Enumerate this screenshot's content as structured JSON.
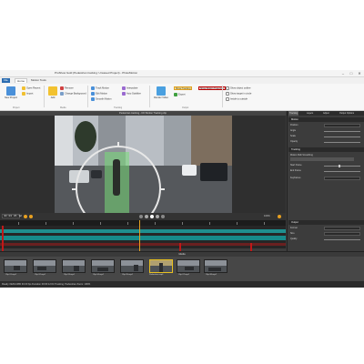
{
  "window": {
    "title": "ProShow Gold (Pedestrian tracking: Unsaved Project) - PhotoMotion",
    "minimize": "–",
    "maximize": "□",
    "close": "✕"
  },
  "menu": {
    "tabs": [
      {
        "label": "File"
      },
      {
        "label": "Home"
      },
      {
        "label": "Motion Tools"
      }
    ]
  },
  "ribbon": {
    "buttons": [
      {
        "label": "New Project"
      },
      {
        "label": "Open Recent"
      },
      {
        "label": "Import"
      },
      {
        "label": "Add"
      },
      {
        "label": "Remove"
      },
      {
        "label": "Change Background"
      },
      {
        "label": "Track Motion"
      },
      {
        "label": "Edit Motion"
      },
      {
        "label": "Smooth Motion"
      },
      {
        "label": "Interpolate"
      },
      {
        "label": "Auto Stabilize"
      },
      {
        "label": "Render Video"
      },
      {
        "label": "Export"
      }
    ],
    "tags": [
      {
        "label": "Show Tracking"
      },
      {
        "label": "Show Motion Trajectory"
      }
    ],
    "groups": [
      {
        "label": "Project"
      },
      {
        "label": "Media"
      },
      {
        "label": "Tracking"
      },
      {
        "label": "Output"
      }
    ],
    "options": [
      {
        "label": "Show object outline"
      },
      {
        "label": "Show target in circle"
      },
      {
        "label": "Inside to outside"
      }
    ]
  },
  "viewer": {
    "header": "Pedestrian tracking - DO Motion Tracking clip",
    "timecode": "00:00:06:12",
    "zoom": "100%"
  },
  "panel": {
    "tabs": [
      {
        "label": "Tracking"
      },
      {
        "label": "Layers"
      },
      {
        "label": "Adjust"
      },
      {
        "label": "Output Options"
      }
    ],
    "sections": [
      {
        "label": "Motion"
      },
      {
        "label": "Tracking"
      },
      {
        "label": "Output"
      }
    ],
    "rows": [
      {
        "label": "Position"
      },
      {
        "label": "Angle"
      },
      {
        "label": "Scale"
      },
      {
        "label": "Opacity"
      },
      {
        "label": "Motion Path Smoothing"
      },
      {
        "label": "Start Frame"
      },
      {
        "label": "End Frame"
      },
      {
        "label": "Keyframes"
      },
      {
        "label": "Format"
      },
      {
        "label": "Size"
      },
      {
        "label": "Quality"
      }
    ]
  },
  "gallery": {
    "header": "Media",
    "items": [
      {
        "label": "Clip 01.mp4"
      },
      {
        "label": "Clip 02.mp4"
      },
      {
        "label": "Clip 03.mp4"
      },
      {
        "label": "Clip 04.mp4"
      },
      {
        "label": "Clip 05.mp4"
      },
      {
        "label": "Pedestrian.mp4"
      },
      {
        "label": "Clip 07.mp4"
      },
      {
        "label": "Clip 08.mp4"
      }
    ]
  },
  "status": {
    "text": "Ready   1920x1080   30.00 fps   Duration 00:00:12:04   Tracking: Pedestrian   Zoom: 100%"
  }
}
